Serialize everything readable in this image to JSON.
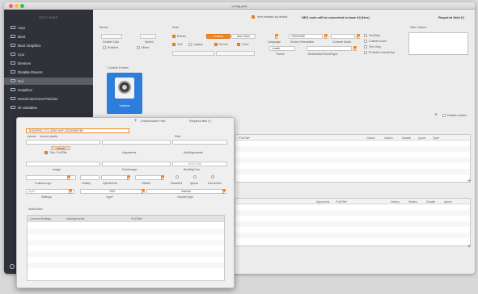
{
  "window": {
    "title": "config.plist"
  },
  "sidebar": {
    "header": "SECTIONS",
    "items": [
      {
        "label": "Acpi"
      },
      {
        "label": "Boot"
      },
      {
        "label": "Boot Graphics"
      },
      {
        "label": "Cpu"
      },
      {
        "label": "Devices"
      },
      {
        "label": "Disable Drivers"
      },
      {
        "label": "Gui"
      },
      {
        "label": "Graphics"
      },
      {
        "label": "Kernel and Kext Patches"
      },
      {
        "label": "Rt Variables"
      }
    ],
    "selected_index": 6
  },
  "header": {
    "item_enabled_default": "Item enabled by default",
    "hex_notice": "HEX code will be converted in base 64 (Hex)",
    "required_field": "Required field (*)"
  },
  "mouse": {
    "title": "Mouse",
    "double_click": "Double Click",
    "speed": "Speed",
    "enabled": "Enabled",
    "mirror": "Mirror"
  },
  "scan": {
    "title": "Scan",
    "entries": "Entries",
    "custom": "Custom",
    "auto_scan": "Auto Scan",
    "tool": "Tool",
    "legacy": "Legacy",
    "kernel": "Kernel",
    "linux": "Linux"
  },
  "language": {
    "title": "Language",
    "value": "Locale",
    "screen_resolution_label": "Screen Resolution",
    "screen_resolution": "1920x1080",
    "console_mode": "Console Mode",
    "theme_label": "Theme",
    "embedded_theme_label": "EmbeddedThemeType"
  },
  "options": {
    "textonly": "TextOnly",
    "show_optimus": "ShowOptimus",
    "custom_icons": "Custom Icons",
    "text_only": "Text Only",
    "provide_console": "ProvideConsoleGop",
    "hide_volume_label": "Hide Volume"
  },
  "custom_entries": {
    "title": "Custom Entries",
    "entry_label": "Volume"
  },
  "tables": {
    "disable_entries_label": "Disable entries",
    "upper_columns": [
      "*FullTitle*",
      "Hotkey",
      "Hidden",
      "Disable",
      "Ignore",
      "Type*"
    ],
    "lower_columns": [
      "Arguments",
      "*FullTitle*",
      "Hotkey",
      "Hidden",
      "Disable",
      "Ignore"
    ]
  },
  "popover": {
    "top": {
      "delete_label": "Delete",
      "uncheckable_fields": "Unchecklable Field",
      "required_field": "Required field (*)"
    },
    "device_path": "BCB39F8D-C7C1-4EB6-9A9F-2DC8DB9EDB8",
    "labels": {
      "volume": "Volume",
      "volume_path": "Volume (path)",
      "path": "Path",
      "type": "Volume",
      "title": "Title / FullTitle",
      "arguments": "Arguments",
      "add_arguments": "AddArguments",
      "image": "Image",
      "drive_image": "DriveImage",
      "boot_bg_color": "BootBgColor",
      "custom_logo": "CustomLogo",
      "hotkey": "Hotkey",
      "injectkexts": "InjectKexts",
      "hidden": "Hidden",
      "disabled": "Disabled",
      "ignore": "Ignore",
      "nocaches": "NoCaches",
      "settings": "Settings",
      "type_field": "Type*",
      "volume_type": "VolumeType",
      "sub_entries": "SubEntries"
    },
    "values": {
      "type_value": "OSX",
      "volume_type_value": "Internal",
      "bgcolor_placeholder": "0xRRGGBB",
      "custom_logo_value": "Apple"
    },
    "subtable_columns": [
      "CommonSettings",
      "AddArguments",
      "*FullTitle*"
    ]
  },
  "colors": {
    "accent": "#f38420",
    "sidebar_bg": "#2f3339",
    "selected_entry": "#2d7ddb"
  }
}
